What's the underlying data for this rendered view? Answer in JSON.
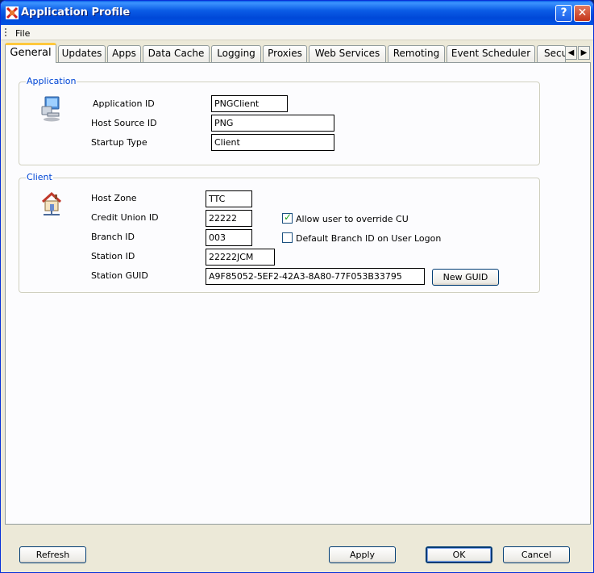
{
  "window": {
    "title": "Application Profile"
  },
  "menu": {
    "file_label": "File"
  },
  "tabs": [
    {
      "label": "General"
    },
    {
      "label": "Updates"
    },
    {
      "label": "Apps"
    },
    {
      "label": "Data Cache"
    },
    {
      "label": "Logging"
    },
    {
      "label": "Proxies"
    },
    {
      "label": "Web Services"
    },
    {
      "label": "Remoting"
    },
    {
      "label": "Event Scheduler"
    },
    {
      "label": "Secu"
    }
  ],
  "application": {
    "group_title": "Application",
    "app_id_label": "Application ID",
    "app_id_value": "PNGClient",
    "host_source_label": "Host Source ID",
    "host_source_value": "PNG",
    "startup_label": "Startup Type",
    "startup_value": "Client",
    "icon": "computer-icon"
  },
  "client": {
    "group_title": "Client",
    "host_zone_label": "Host Zone",
    "host_zone_value": "TTC",
    "credit_union_label": "Credit Union ID",
    "credit_union_value": "22222",
    "branch_label": "Branch ID",
    "branch_value": "003",
    "station_label": "Station ID",
    "station_value": "22222JCM",
    "guid_label": "Station GUID",
    "guid_value": "A9F85052-5EF2-42A3-8A80-77F053B33795",
    "new_guid_label": "New GUID",
    "override_label": "Allow user to override CU",
    "override_checked": true,
    "default_branch_label": "Default Branch ID on User Logon",
    "default_branch_checked": false,
    "icon": "house-network-icon"
  },
  "footer": {
    "refresh_label": "Refresh",
    "apply_label": "Apply",
    "ok_label": "OK",
    "cancel_label": "Cancel"
  }
}
